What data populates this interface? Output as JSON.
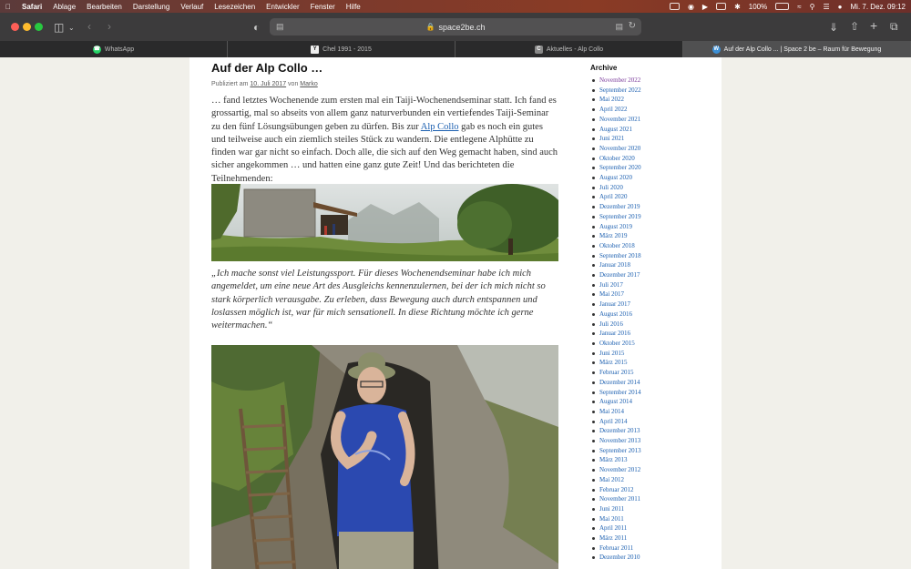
{
  "menubar": {
    "app": "Safari",
    "items": [
      "Ablage",
      "Bearbeiten",
      "Darstellung",
      "Verlauf",
      "Lesezeichen",
      "Entwickler",
      "Fenster",
      "Hilfe"
    ],
    "battery": "100%",
    "datetime": "Mi. 7. Dez.  09:12"
  },
  "toolbar": {
    "url": "space2be.ch"
  },
  "tabs": [
    {
      "label": "WhatsApp",
      "icon": "whatsapp-icon"
    },
    {
      "label": "Chel 1991 - 2015",
      "icon": "y-favicon"
    },
    {
      "label": "Aktuelles - Alp Collo",
      "icon": "c-favicon"
    },
    {
      "label": "Auf der Alp Collo ... | Space 2 be – Raum für Bewegung",
      "icon": "wordpress-icon"
    }
  ],
  "article": {
    "title": "Auf der Alp Collo …",
    "meta_prefix": "Publiziert am ",
    "date": "10. Juli 2017",
    "meta_by": " von ",
    "author": "Marko",
    "intro_before": "… fand letztes Wochenende zum ersten mal ein Taiji-Wochenendseminar statt. Ich fand es grossartig, mal so abseits von allem ganz naturverbunden ein vertiefendes Taiji-Seminar zu den fünf Lösungsübungen geben zu dürfen. Bis zur ",
    "intro_link": "Alp Collo",
    "intro_after": " gab es noch ein gutes und teilweise auch ein ziemlich steiles Stück zu wandern. Die entlegene Alphütte zu finden war gar nicht so einfach. Doch alle, die sich auf den Weg gemacht haben, sind auch sicher angekommen … und hatten eine ganz gute Zeit! Und das berichteten die Teilnehmenden:",
    "quote": "„Ich mache sonst viel Leistungssport. Für dieses Wochenendseminar habe ich mich angemeldet, um eine neue Art des Ausgleichs kennenzulernen, bei der ich mich nicht so stark körperlich verausgabe. Zu erleben, dass Bewegung auch durch entspannen und loslassen möglich ist, war für mich sensationell. In diese Richtung möchte ich gerne weitermachen.“"
  },
  "sidebar": {
    "heading": "Archive",
    "items": [
      "November 2022",
      "September 2022",
      "Mai 2022",
      "April 2022",
      "November 2021",
      "August 2021",
      "Juni 2021",
      "November 2020",
      "Oktober 2020",
      "September 2020",
      "August 2020",
      "Juli 2020",
      "April 2020",
      "Dezember 2019",
      "September 2019",
      "August 2019",
      "März 2019",
      "Oktober 2018",
      "September 2018",
      "Januar 2018",
      "Dezember 2017",
      "Juli 2017",
      "Mai 2017",
      "Januar 2017",
      "August 2016",
      "Juli 2016",
      "Januar 2016",
      "Oktober 2015",
      "Juni 2015",
      "März 2015",
      "Februar 2015",
      "Dezember 2014",
      "September 2014",
      "August 2014",
      "Mai 2014",
      "April 2014",
      "Dezember 2013",
      "November 2013",
      "September 2013",
      "März 2013",
      "November 2012",
      "Mai 2012",
      "Februar 2012",
      "November 2011",
      "Juni 2011",
      "Mai 2011",
      "April 2011",
      "März 2011",
      "Februar 2011",
      "Dezember 2010"
    ]
  }
}
